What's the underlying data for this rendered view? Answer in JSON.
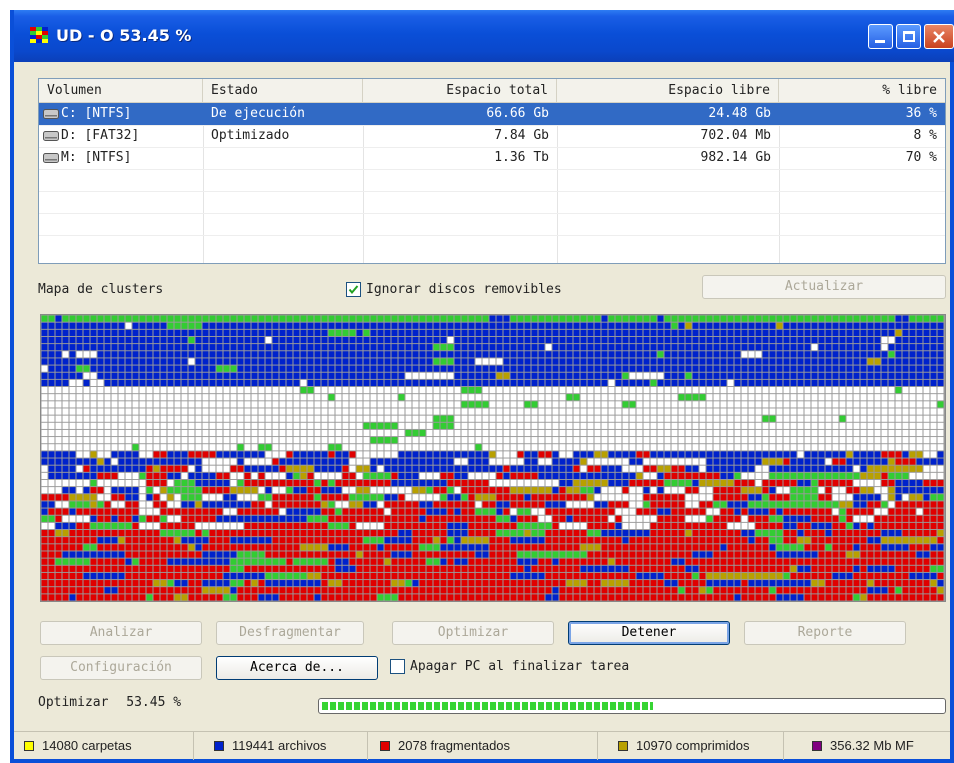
{
  "window": {
    "title": "UD - O 53.45 %"
  },
  "volumes": {
    "headers": [
      "Volumen",
      "Estado",
      "Espacio total",
      "Espacio libre",
      "% libre"
    ],
    "rows": [
      {
        "volume": "C: [NTFS]",
        "status": "De ejecución",
        "total": "66.66 Gb",
        "free": "24.48 Gb",
        "pct": "36 %",
        "selected": true
      },
      {
        "volume": "D: [FAT32]",
        "status": "Optimizado",
        "total": "7.84 Gb",
        "free": "702.04 Mb",
        "pct": "8 %",
        "selected": false
      },
      {
        "volume": "M: [NTFS]",
        "status": "",
        "total": "1.36 Tb",
        "free": "982.14 Gb",
        "pct": "70 %",
        "selected": false
      }
    ]
  },
  "map": {
    "label": "Mapa de clusters",
    "ignore_removable": {
      "label": "Ignorar discos removibles",
      "checked": true
    },
    "refresh_label": "Actualizar",
    "colors": {
      "free": "#FFFFFF",
      "fragmented": "#E00000",
      "files": "#0022CC",
      "compressed": "#B8A000",
      "directories": "#FFFF00",
      "green": "#33CC33"
    }
  },
  "buttons": {
    "analyze": "Analizar",
    "defrag": "Desfragmentar",
    "optimize": "Optimizar",
    "stop": "Detener",
    "report": "Reporte",
    "config": "Configuración",
    "about": "Acerca de..."
  },
  "shutdown": {
    "label": "Apagar PC al finalizar tarea",
    "checked": false
  },
  "progress": {
    "label": "Optimizar",
    "value_text": "53.45 %",
    "fraction": 0.5345
  },
  "status": {
    "folders": "14080 carpetas",
    "files": "119441 archivos",
    "fragmented": "2078 fragmentados",
    "compressed": "10970 comprimidos",
    "mft": "356.32 Mb MF",
    "colors": {
      "folders": "#FFFF00",
      "files": "#0022CC",
      "fragmented": "#E00000",
      "compressed": "#B8A000",
      "mft": "#800080"
    }
  }
}
